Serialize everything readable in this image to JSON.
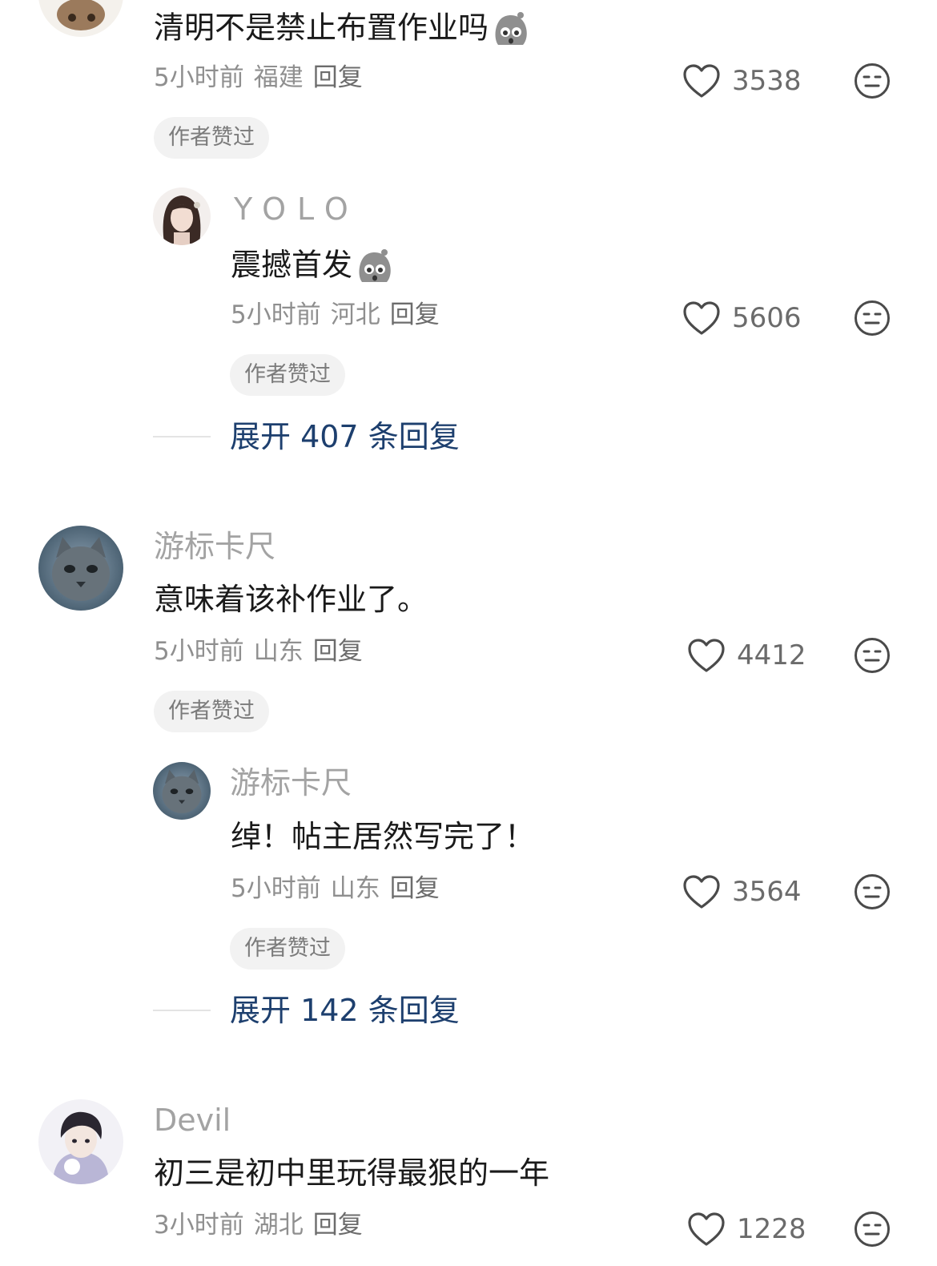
{
  "comments": [
    {
      "text": "清明不是禁止布置作业吗",
      "time": "5小时前",
      "region": "福建",
      "reply_label": "回复",
      "likes": "3538",
      "badge": "作者赞过",
      "replies": [
        {
          "username": "YOLO",
          "text": "震撼首发",
          "time": "5小时前",
          "region": "河北",
          "reply_label": "回复",
          "likes": "5606",
          "badge": "作者赞过"
        }
      ],
      "expand_label": "展开 407 条回复"
    },
    {
      "username": "游标卡尺",
      "text": "意味着该补作业了。",
      "time": "5小时前",
      "region": "山东",
      "reply_label": "回复",
      "likes": "4412",
      "badge": "作者赞过",
      "replies": [
        {
          "username": "游标卡尺",
          "text": "绰！帖主居然写完了！",
          "time": "5小时前",
          "region": "山东",
          "reply_label": "回复",
          "likes": "3564",
          "badge": "作者赞过"
        }
      ],
      "expand_label": "展开 142 条回复"
    },
    {
      "username": "Devil",
      "text": "初三是初中里玩得最狠的一年",
      "time": "3小时前",
      "region": "湖北",
      "reply_label": "回复",
      "likes": "1228"
    }
  ],
  "icons": {
    "like": "heart-outline-icon",
    "dislike": "neutral-face-icon",
    "emoji": "shocked-gray-face-emoji"
  },
  "colors": {
    "primary_text": "#1a1a1a",
    "username": "#a3a3a3",
    "meta": "#8f8f8f",
    "expand_link": "#1d3f6e",
    "badge_bg": "#f2f2f2"
  }
}
